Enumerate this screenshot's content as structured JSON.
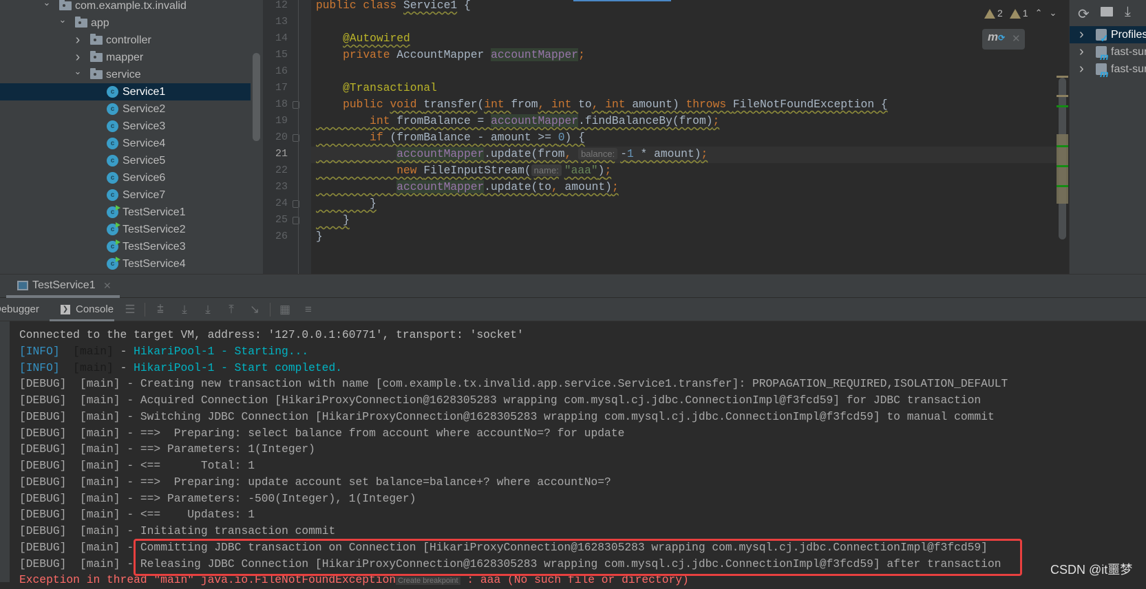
{
  "project_tree": [
    {
      "label": "com.example.tx.invalid",
      "level": 0,
      "type": "folder",
      "expanded": true
    },
    {
      "label": "app",
      "level": 1,
      "type": "folder",
      "expanded": true
    },
    {
      "label": "controller",
      "level": 2,
      "type": "folder",
      "expanded": false
    },
    {
      "label": "mapper",
      "level": 2,
      "type": "folder",
      "expanded": false
    },
    {
      "label": "service",
      "level": 2,
      "type": "folder",
      "expanded": true
    },
    {
      "label": "Service1",
      "level": 3,
      "type": "class",
      "selected": true
    },
    {
      "label": "Service2",
      "level": 3,
      "type": "class"
    },
    {
      "label": "Service3",
      "level": 3,
      "type": "class"
    },
    {
      "label": "Service4",
      "level": 3,
      "type": "class"
    },
    {
      "label": "Service5",
      "level": 3,
      "type": "class"
    },
    {
      "label": "Service6",
      "level": 3,
      "type": "class"
    },
    {
      "label": "Service7",
      "level": 3,
      "type": "class"
    },
    {
      "label": "TestService1",
      "level": 3,
      "type": "test-class"
    },
    {
      "label": "TestService2",
      "level": 3,
      "type": "test-class"
    },
    {
      "label": "TestService3",
      "level": 3,
      "type": "test-class"
    },
    {
      "label": "TestService4",
      "level": 3,
      "type": "test-class"
    }
  ],
  "editor": {
    "current_line": 21,
    "warnings": {
      "warning_count": "2",
      "weak_warning_count": "1",
      "icon": "warning-triangle-icon"
    },
    "maven_popup_icon": "maven-reload-icon",
    "lines": [
      {
        "n": "12",
        "fold": "",
        "wavy": false,
        "tokens": [
          [
            "public class ",
            "kw"
          ],
          [
            "Service1",
            "wv"
          ],
          [
            " {",
            ""
          ]
        ]
      },
      {
        "n": "13",
        "fold": "",
        "wavy": false,
        "tokens": []
      },
      {
        "n": "14",
        "fold": "",
        "wavy": false,
        "tokens": [
          [
            "    ",
            ""
          ],
          [
            "@Autowired",
            "ann wv"
          ]
        ]
      },
      {
        "n": "15",
        "fold": "",
        "wavy": false,
        "tokens": [
          [
            "    ",
            ""
          ],
          [
            "private ",
            "kw"
          ],
          [
            "AccountMapper ",
            ""
          ],
          [
            "accountMapper",
            "fld"
          ],
          [
            ";",
            "kw"
          ]
        ]
      },
      {
        "n": "16",
        "fold": "",
        "wavy": false,
        "tokens": []
      },
      {
        "n": "17",
        "fold": "",
        "wavy": false,
        "tokens": [
          [
            "    ",
            ""
          ],
          [
            "@Transactional",
            "ann"
          ]
        ]
      },
      {
        "n": "18",
        "fold": "open",
        "wavy": false,
        "tokens": [
          [
            "    ",
            ""
          ],
          [
            "public ",
            "kw"
          ],
          [
            "void ",
            "kw wv"
          ],
          [
            "transfer",
            "wv"
          ],
          [
            "(",
            ""
          ],
          [
            "int ",
            "kw wv"
          ],
          [
            "from",
            ""
          ],
          [
            ", ",
            "kw wv"
          ],
          [
            "int ",
            "kw wv"
          ],
          [
            "to",
            ""
          ],
          [
            ", ",
            "kw wv"
          ],
          [
            "int ",
            "kw wv"
          ],
          [
            "amount) ",
            "wv"
          ],
          [
            "throws ",
            "kw wv"
          ],
          [
            "FileNotFoundException {",
            "wv"
          ]
        ]
      },
      {
        "n": "19",
        "fold": "",
        "wavy": true,
        "tokens": [
          [
            "        ",
            ""
          ],
          [
            "int ",
            "kw"
          ],
          [
            "fromBalance = ",
            ""
          ],
          [
            "accountMapper",
            "fld"
          ],
          [
            ".findBalanceBy(from)",
            ""
          ],
          [
            ";",
            "kw"
          ]
        ]
      },
      {
        "n": "20",
        "fold": "open",
        "wavy": true,
        "tokens": [
          [
            "        ",
            ""
          ],
          [
            "if ",
            "kw"
          ],
          [
            "(fromBalance - amount >= ",
            ""
          ],
          [
            "0",
            "num"
          ],
          [
            ") {",
            ""
          ]
        ]
      },
      {
        "n": "21",
        "fold": "",
        "wavy": true,
        "tokens": [
          [
            "            ",
            ""
          ],
          [
            "accountMapper",
            "fld"
          ],
          [
            ".update(from",
            ""
          ],
          [
            ", ",
            "kw"
          ],
          [
            "balance:",
            "hint"
          ],
          [
            "-",
            ""
          ],
          [
            "1",
            "num"
          ],
          [
            " * amount)",
            ""
          ],
          [
            ";",
            "kw"
          ]
        ]
      },
      {
        "n": "22",
        "fold": "",
        "wavy": true,
        "tokens": [
          [
            "            ",
            ""
          ],
          [
            "new ",
            "kw"
          ],
          [
            "FileInputStream(",
            ""
          ],
          [
            "name:",
            "hint"
          ],
          [
            "\"aaa\"",
            "str"
          ],
          [
            ")",
            ""
          ],
          [
            ";",
            "kw"
          ]
        ]
      },
      {
        "n": "23",
        "fold": "",
        "wavy": true,
        "tokens": [
          [
            "            ",
            ""
          ],
          [
            "accountMapper",
            "fld"
          ],
          [
            ".update(to",
            ""
          ],
          [
            ", ",
            "kw"
          ],
          [
            "amount)",
            ""
          ],
          [
            ";",
            "kw"
          ]
        ]
      },
      {
        "n": "24",
        "fold": "close",
        "wavy": true,
        "tokens": [
          [
            "        }",
            ""
          ]
        ]
      },
      {
        "n": "25",
        "fold": "close",
        "wavy": true,
        "tokens": [
          [
            "    }",
            ""
          ]
        ]
      },
      {
        "n": "26",
        "fold": "",
        "wavy": false,
        "tokens": [
          [
            "}",
            ""
          ]
        ]
      }
    ]
  },
  "maven_panel": {
    "toolbar_icons": [
      "refresh-icon",
      "folder-reload-icon",
      "download-icon"
    ],
    "items": [
      {
        "label": "Profiles",
        "icon": "profiles-folder-icon",
        "selected": true
      },
      {
        "label": "fast-sur",
        "icon": "maven-module-icon"
      },
      {
        "label": "fast-sur",
        "icon": "maven-module-icon"
      }
    ]
  },
  "run_panel": {
    "tab_label": "TestService1",
    "debugger_label": "Debugger",
    "console_label": "Console",
    "toolbar_icons": [
      "threads-icon",
      "step-over-icon",
      "step-into-icon",
      "force-step-into-icon",
      "step-out-icon",
      "run-to-cursor-icon",
      "evaluate-icon",
      "trace-icon"
    ]
  },
  "console": {
    "connected": "Connected to the target VM, address: '127.0.0.1:60771', transport: 'socket'",
    "lines": [
      {
        "level": "[INFO]",
        "thread": "[main]",
        "msg": "HikariPool-1 - Starting...",
        "kind": "info"
      },
      {
        "level": "[INFO]",
        "thread": "[main]",
        "msg": "HikariPool-1 - Start completed.",
        "kind": "info"
      },
      {
        "level": "[DEBUG]",
        "thread": "[main]",
        "msg": "Creating new transaction with name [com.example.tx.invalid.app.service.Service1.transfer]: PROPAGATION_REQUIRED,ISOLATION_DEFAULT",
        "kind": "debug"
      },
      {
        "level": "[DEBUG]",
        "thread": "[main]",
        "msg": "Acquired Connection [HikariProxyConnection@1628305283 wrapping com.mysql.cj.jdbc.ConnectionImpl@f3fcd59] for JDBC transaction",
        "kind": "debug"
      },
      {
        "level": "[DEBUG]",
        "thread": "[main]",
        "msg": "Switching JDBC Connection [HikariProxyConnection@1628305283 wrapping com.mysql.cj.jdbc.ConnectionImpl@f3fcd59] to manual commit",
        "kind": "debug"
      },
      {
        "level": "[DEBUG]",
        "thread": "[main]",
        "msg": "==>  Preparing: select balance from account where accountNo=? for update",
        "kind": "debug"
      },
      {
        "level": "[DEBUG]",
        "thread": "[main]",
        "msg": "==> Parameters: 1(Integer)",
        "kind": "debug"
      },
      {
        "level": "[DEBUG]",
        "thread": "[main]",
        "msg": "<==      Total: 1",
        "kind": "debug"
      },
      {
        "level": "[DEBUG]",
        "thread": "[main]",
        "msg": "==>  Preparing: update account set balance=balance+? where accountNo=?",
        "kind": "debug"
      },
      {
        "level": "[DEBUG]",
        "thread": "[main]",
        "msg": "==> Parameters: -500(Integer), 1(Integer)",
        "kind": "debug"
      },
      {
        "level": "[DEBUG]",
        "thread": "[main]",
        "msg": "<==    Updates: 1",
        "kind": "debug"
      },
      {
        "level": "[DEBUG]",
        "thread": "[main]",
        "msg": "Initiating transaction commit",
        "kind": "debug"
      },
      {
        "level": "[DEBUG]",
        "thread": "[main]",
        "msg": "Committing JDBC transaction on Connection [HikariProxyConnection@1628305283 wrapping com.mysql.cj.jdbc.ConnectionImpl@f3fcd59]",
        "kind": "debug"
      },
      {
        "level": "[DEBUG]",
        "thread": "[main]",
        "msg": "Releasing JDBC Connection [HikariProxyConnection@1628305283 wrapping com.mysql.cj.jdbc.ConnectionImpl@f3fcd59] after transaction",
        "kind": "debug"
      }
    ],
    "exception": {
      "prefix": "Exception in thread \"main\" java.io.FileNotFoundException",
      "breakpoint_link": "Create breakpoint",
      "suffix": " : aaa (No such file or directory)"
    },
    "highlight_color": "#e8403f"
  },
  "watermark": "CSDN @it噩梦"
}
